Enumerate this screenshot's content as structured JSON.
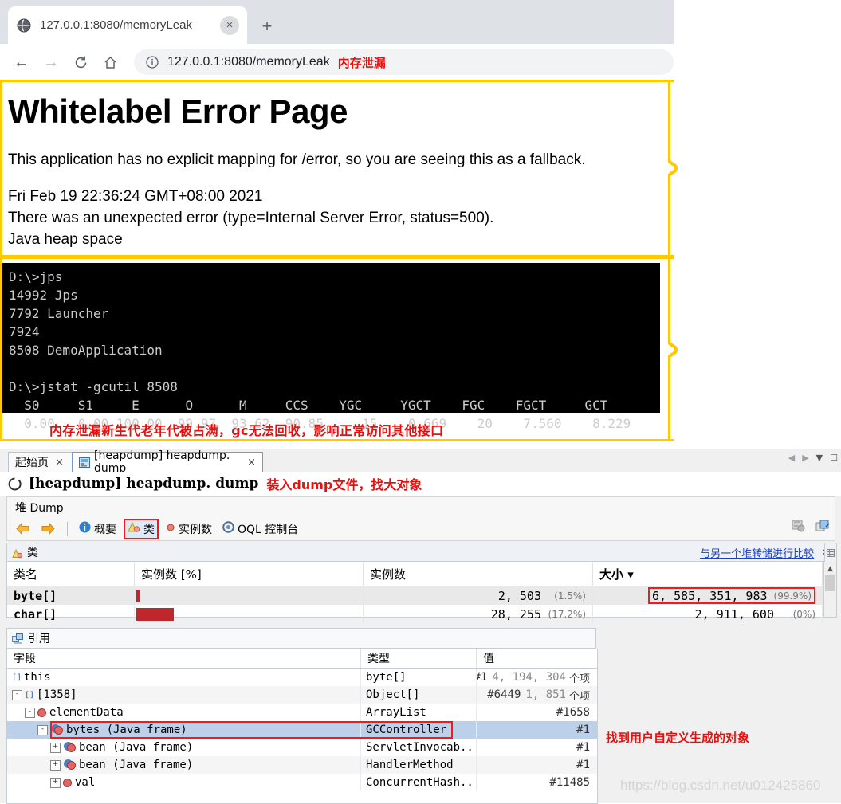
{
  "browser": {
    "tab": {
      "title": "127.0.0.1:8080/memoryLeak",
      "favicon": "globe-icon",
      "close": "×"
    },
    "new_tab": "+",
    "nav": {
      "back": "←",
      "forward": "→",
      "reload": "↻",
      "home": "⌂"
    },
    "omnibox": {
      "info_icon": "info-icon",
      "url": "127.0.0.1:8080/memoryLeak",
      "annotation": "内存泄漏"
    }
  },
  "error_page": {
    "title": "Whitelabel Error Page",
    "paragraph": "This application has no explicit mapping for /error, so you are seeing this as a fallback.",
    "timestamp": "Fri Feb 19 22:36:24 GMT+08:00 2021",
    "error_line": "There was an unexpected error (type=Internal Server Error, status=500).",
    "message": "Java heap space"
  },
  "console": {
    "lines": [
      "D:\\>jps",
      "14992 Jps",
      "7792 Launcher",
      "7924",
      "8508 DemoApplication",
      "",
      "D:\\>jstat -gcutil 8508",
      "  S0     S1     E      O      M     CCS    YGC     YGCT    FGC    FGCT     GCT",
      "  0.00   0.00 100.00  99.97  93.62  90.85     15    0.669    20    7.560    8.229"
    ],
    "annotation": "内存泄漏新生代老年代被占满，gc无法回收，影响正常访问其他接口",
    "gcutil": {
      "headers": [
        "S0",
        "S1",
        "E",
        "O",
        "M",
        "CCS",
        "YGC",
        "YGCT",
        "FGC",
        "FGCT",
        "GCT"
      ],
      "values": [
        "0.00",
        "0.00",
        "100.00",
        "99.97",
        "93.62",
        "90.85",
        "15",
        "0.669",
        "20",
        "7.560",
        "8.229"
      ]
    }
  },
  "visualvm": {
    "tabs": [
      {
        "label": "起始页",
        "close": "×",
        "icon": "",
        "active": false
      },
      {
        "label": "[heapdump] heapdump. dump",
        "close": "×",
        "icon": "heapdump-icon",
        "active": true
      }
    ],
    "tabs_right": {
      "prev": "◀",
      "next": "▶",
      "dropdown": "▼",
      "maximize": "☐"
    },
    "header": {
      "spinner_icon": "loading-spinner-icon",
      "title": "[heapdump] heapdump. dump",
      "annotation": "装入dump文件，找大对象"
    },
    "subtab": "堆 Dump",
    "toolbar": {
      "back": "←",
      "forward": "→",
      "items": [
        {
          "label": "概要",
          "icon": "info-circle-icon",
          "selected": false
        },
        {
          "label": "类",
          "icon": "classes-icon",
          "selected": true
        },
        {
          "label": "实例数",
          "icon": "instance-dot-icon",
          "selected": false
        },
        {
          "label": "OQL 控制台",
          "icon": "oql-icon",
          "selected": false
        }
      ],
      "right_icons": [
        "heapwalker-icon",
        "compare-icon"
      ]
    },
    "classes_panel": {
      "icon": "classes-icon",
      "title": "类",
      "compare_link": "与另一个堆转储进行比较",
      "close": "×",
      "side_icon": "table-icon"
    },
    "classes_table": {
      "columns": [
        "类名",
        "实例数 [%]",
        "实例数",
        "大小 ▾"
      ],
      "rows": [
        {
          "name": "byte[]",
          "bar_pct": 1.5,
          "instances": "2, 503",
          "instances_pct": "(1.5%)",
          "size": "6, 585, 351, 983",
          "size_pct": "(99.9%)",
          "highlight": true
        },
        {
          "name": "char[]",
          "bar_pct": 17.2,
          "instances": "28, 255",
          "instances_pct": "(17.2%)",
          "size": "2, 911, 600",
          "size_pct": "(0%)",
          "highlight": false
        }
      ],
      "scroll": {
        "up": "▲",
        "down": "▼"
      }
    },
    "references_panel": {
      "icon": "references-icon",
      "title": "引用"
    },
    "references_table": {
      "columns": [
        "字段",
        "类型",
        "值"
      ],
      "rows": [
        {
          "indent": 0,
          "expander": "",
          "icon": "field-array-icon",
          "field": "this",
          "type": "byte[]",
          "hash": "#1",
          "num": "4, 194, 304",
          "unit": "个项",
          "selected": false,
          "highlight": false
        },
        {
          "indent": 0,
          "expander": "-",
          "icon": "field-array-icon",
          "field": "[1358]",
          "type": "Object[]",
          "hash": "#6449",
          "num": "1, 851",
          "unit": "个项",
          "selected": false,
          "highlight": false
        },
        {
          "indent": 1,
          "expander": "-",
          "icon": "instance-dot-icon",
          "field": "elementData",
          "type": "ArrayList",
          "hash": "#1658",
          "num": "",
          "unit": "",
          "selected": false,
          "highlight": false
        },
        {
          "indent": 2,
          "expander": "-",
          "icon": "java-frame-icon",
          "field": "bytes (Java frame)",
          "type": "GCController",
          "hash": "#1",
          "num": "",
          "unit": "",
          "selected": true,
          "highlight": true
        },
        {
          "indent": 3,
          "expander": "+",
          "icon": "java-frame-icon",
          "field": "bean (Java frame)",
          "type": "ServletInvocab...",
          "hash": "#1",
          "num": "",
          "unit": "",
          "selected": false,
          "highlight": false
        },
        {
          "indent": 3,
          "expander": "+",
          "icon": "java-frame-icon",
          "field": "bean (Java frame)",
          "type": "HandlerMethod",
          "hash": "#1",
          "num": "",
          "unit": "",
          "selected": false,
          "highlight": false
        },
        {
          "indent": 3,
          "expander": "+",
          "icon": "instance-dot-icon",
          "field": "val",
          "type": "ConcurrentHash...",
          "hash": "#11485",
          "num": "",
          "unit": "",
          "selected": false,
          "highlight": false
        }
      ],
      "annotation": "找到用户自定义生成的对象"
    }
  },
  "watermark": "https://blog.csdn.net/u012425860",
  "colors": {
    "callout_yellow": "#FFC800",
    "annotation_red": "#E8100F",
    "highlight_red": "#EE1C1C",
    "bar_red": "#C0272D",
    "selection_blue": "#BCD0EA",
    "link_blue": "#1A3FC4"
  }
}
